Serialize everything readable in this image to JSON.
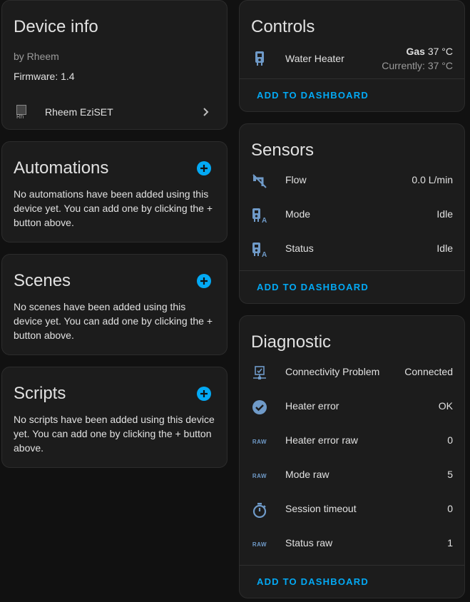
{
  "device_info": {
    "title": "Device info",
    "manufacturer": "by Rheem",
    "firmware": "Firmware: 1.4",
    "integration_name": "Rheem EziSET",
    "logo_alt": "Rh"
  },
  "automations": {
    "title": "Automations",
    "text": "No automations have been added using this device yet. You can add one by clicking the + button above."
  },
  "scenes": {
    "title": "Scenes",
    "text": "No scenes have been added using this device yet. You can add one by clicking the + button above."
  },
  "scripts": {
    "title": "Scripts",
    "text": "No scripts have been added using this device yet. You can add one by clicking the + button above."
  },
  "controls": {
    "title": "Controls",
    "entity_label": "Water Heater",
    "mode_bold": "Gas",
    "target_temp": "37 °C",
    "current": "Currently: 37 °C",
    "add_label": "ADD TO DASHBOARD"
  },
  "sensors": {
    "title": "Sensors",
    "rows": [
      {
        "label": "Flow",
        "value": "0.0 L/min",
        "icon": "water-off-icon"
      },
      {
        "label": "Mode",
        "value": "Idle",
        "icon": "water-heater-text-icon"
      },
      {
        "label": "Status",
        "value": "Idle",
        "icon": "water-heater-text-icon"
      }
    ],
    "add_label": "ADD TO DASHBOARD"
  },
  "diagnostic": {
    "title": "Diagnostic",
    "rows": [
      {
        "label": "Connectivity Problem",
        "value": "Connected",
        "icon": "lan-check-icon"
      },
      {
        "label": "Heater error",
        "value": "OK",
        "icon": "check-circle-icon"
      },
      {
        "label": "Heater error raw",
        "value": "0",
        "icon": "raw-icon"
      },
      {
        "label": "Mode raw",
        "value": "5",
        "icon": "raw-icon"
      },
      {
        "label": "Session timeout",
        "value": "0",
        "icon": "timer-icon"
      },
      {
        "label": "Status raw",
        "value": "1",
        "icon": "raw-icon"
      }
    ],
    "raw_icon_text": "RAW",
    "add_label": "ADD TO DASHBOARD"
  },
  "colors": {
    "accent": "#03a9f4",
    "icon": "#6f9ac8",
    "card_bg": "#1c1c1c",
    "page_bg": "#111111"
  }
}
